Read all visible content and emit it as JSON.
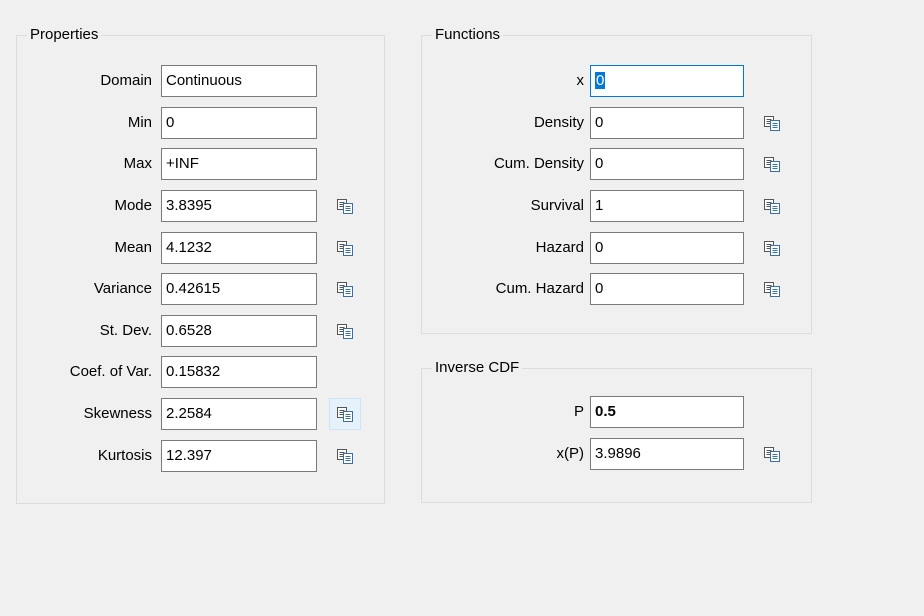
{
  "properties": {
    "title": "Properties",
    "rows": [
      {
        "label": "Domain",
        "value": "Continuous"
      },
      {
        "label": "Min",
        "value": "0"
      },
      {
        "label": "Max",
        "value": "+INF"
      },
      {
        "label": "Mode",
        "value": "3.8395"
      },
      {
        "label": "Mean",
        "value": "4.1232"
      },
      {
        "label": "Variance",
        "value": "0.42615"
      },
      {
        "label": "St. Dev.",
        "value": "0.6528"
      },
      {
        "label": "Coef. of Var.",
        "value": "0.15832"
      },
      {
        "label": "Skewness",
        "value": "2.2584"
      },
      {
        "label": "Kurtosis",
        "value": "12.397"
      }
    ]
  },
  "functions": {
    "title": "Functions",
    "x_label": "x",
    "x_value": "0",
    "rows": [
      {
        "label": "Density",
        "value": "0"
      },
      {
        "label": "Cum. Density",
        "value": "0"
      },
      {
        "label": "Survival",
        "value": "1"
      },
      {
        "label": "Hazard",
        "value": "0"
      },
      {
        "label": "Cum. Hazard",
        "value": "0"
      }
    ]
  },
  "inverse_cdf": {
    "title": "Inverse CDF",
    "p_label": "P",
    "p_value": "0.5",
    "xp_label": "x(P)",
    "xp_value": "3.9896"
  },
  "icons": {
    "copy": "copy-icon"
  }
}
